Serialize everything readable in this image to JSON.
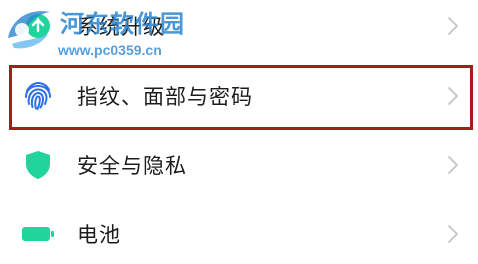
{
  "watermark": {
    "title": "河东软件园",
    "url": "www.pc0359.cn"
  },
  "settings": {
    "items": [
      {
        "label": "系统升级",
        "icon": "system-update-icon"
      },
      {
        "label": "指纹、面部与密码",
        "icon": "fingerprint-icon"
      },
      {
        "label": "安全与隐私",
        "icon": "shield-icon"
      },
      {
        "label": "电池",
        "icon": "battery-icon"
      }
    ],
    "chevron_icon": "chevron-right-icon"
  },
  "colors": {
    "accent_green": "#21d49b",
    "fingerprint_blue": "#2f6fe6",
    "highlight_border": "#a61b1b",
    "chevron": "#c4c4c4",
    "watermark_blue": "#2a86d0"
  }
}
